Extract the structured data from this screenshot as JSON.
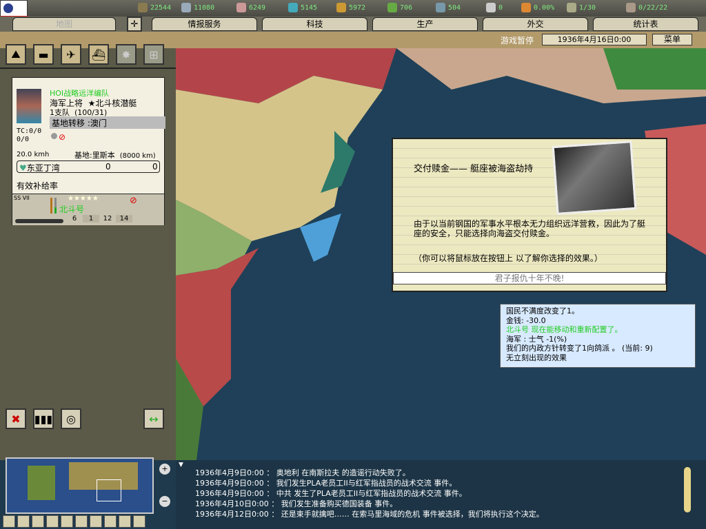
{
  "resources": [
    {
      "icon": "energy-icon",
      "value": "22544",
      "color": "#8a7a50"
    },
    {
      "icon": "metal-icon",
      "value": "11080",
      "color": "#9ab"
    },
    {
      "icon": "rare-materials-icon",
      "value": "6249",
      "color": "#c99"
    },
    {
      "icon": "oil-icon",
      "value": "5145",
      "color": "#4ab"
    },
    {
      "icon": "supplies-icon",
      "value": "5972",
      "color": "#c93"
    },
    {
      "icon": "money-icon",
      "value": "706",
      "color": "#6a4"
    },
    {
      "icon": "manpower-icon",
      "value": "504",
      "color": "#79a"
    },
    {
      "icon": "transports-icon",
      "value": "0",
      "color": "#ccc"
    },
    {
      "icon": "dissent-icon",
      "value": "0.00%",
      "color": "#d83"
    },
    {
      "icon": "convoy-icon",
      "value": "1/30",
      "color": "#aa8"
    },
    {
      "icon": "officers-icon",
      "value": "0/22/22",
      "color": "#a98"
    }
  ],
  "tabs": [
    "地图",
    "情报服务",
    "科技",
    "生产",
    "外交",
    "统计表"
  ],
  "datebar": {
    "status": "游戏暂停",
    "date": "1936年4月16日0:00",
    "menu": "菜单"
  },
  "unit": {
    "name": "HOI战略远洋编队",
    "rank": "海军上将",
    "leader": "★北斗核潜艇",
    "size": "1支队",
    "strength": "(100/31)",
    "mission": "基地转移 :澳门",
    "tc": "TC:0/0",
    "tc2": "0/0",
    "speed": "20.0 kmh",
    "base": "基地:里斯本",
    "range": "(8000 km)",
    "region": "东亚丁湾",
    "region_v1": "0",
    "region_v2": "0",
    "supply": "有效补给率",
    "ship_class": "SS VII",
    "ship_name": "北斗号",
    "stars": "★★★★★",
    "stats": [
      "6",
      "1",
      "12",
      "14"
    ]
  },
  "event": {
    "title": "交付赎金—— 艇座被海盗劫持",
    "body": "由于以当前钢国的军事水平根本无力组织远洋营救，因此为了艇座的安全，只能选择向海盗交付赎金。",
    "hint": "（你可以将鼠标放在按钮上 以了解你选择的效果。）",
    "option": "君子报仇十年不晚!"
  },
  "tooltip": {
    "lines": [
      "国民不满度改变了1。",
      "金钱: -30.0",
      "北斗号 现在能移动和重新配置了。",
      "海军 : 士气 -1(%)",
      "我们的内政方针转变了1向鸽派 。 (当前: 9)",
      "无立刻出现的效果"
    ],
    "highlight_color": "#22cc22"
  },
  "log": [
    {
      "date": "1936年4月9日0:00",
      "text": "： 奥地利 在南斯拉夫 的造谣行动失败了。"
    },
    {
      "date": "1936年4月9日0:00",
      "text": "： 我们发生PLA老员工II与红军指战员的战术交流 事件。"
    },
    {
      "date": "1936年4月9日0:00",
      "text": "： 中共 发生了PLA老员工II与红军指战员的战术交流 事件。"
    },
    {
      "date": "1936年4月10日0:00",
      "text": "： 我们发生准备购买德国装备 事件。"
    },
    {
      "date": "1936年4月12日0:00",
      "text": "： 还是束手就擒吧…… 在索马里海域的危机 事件被选择，我们将执行这个决定。"
    }
  ]
}
